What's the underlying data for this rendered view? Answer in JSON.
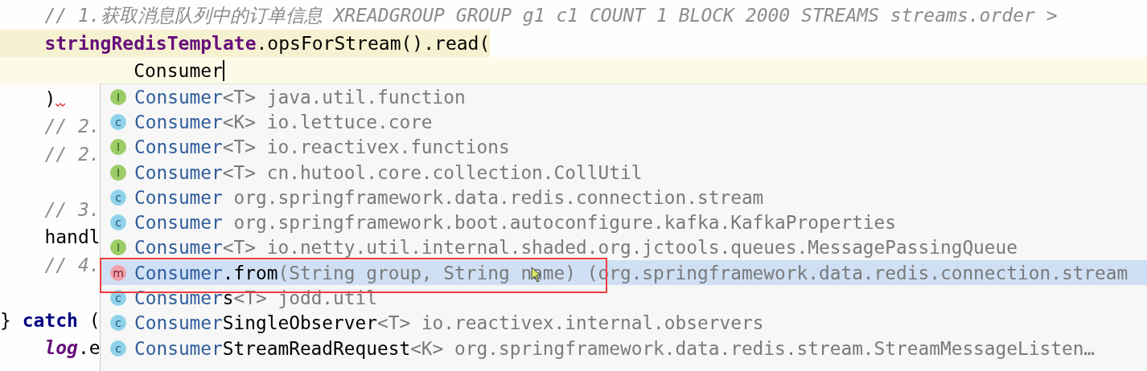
{
  "editor": {
    "lines": [
      {
        "segments": [
          {
            "kind": "comment",
            "text": "    // 1.获取消息队列中的订单信息 XREADGROUP GROUP g1 c1 COUNT 1 BLOCK 2000 STREAMS streams.order >"
          }
        ]
      },
      {
        "segments": [
          {
            "kind": "field",
            "text": "    stringRedisTemplate"
          },
          {
            "kind": "plain",
            "text": ".opsForStream().read("
          }
        ],
        "highlighted": true
      },
      {
        "segments": [
          {
            "kind": "plain",
            "text": "            Consumer"
          }
        ],
        "current": true,
        "caret": true
      },
      {
        "segments": [
          {
            "kind": "plain",
            "text": "    )"
          }
        ],
        "error": true
      },
      {
        "segments": [
          {
            "kind": "comment",
            "text": "    // 2."
          }
        ]
      },
      {
        "segments": [
          {
            "kind": "comment",
            "text": "    // 2."
          }
        ]
      },
      {
        "kind": "blank"
      },
      {
        "segments": [
          {
            "kind": "comment",
            "text": "    // 3."
          }
        ]
      },
      {
        "segments": [
          {
            "kind": "plain",
            "text": "    handl"
          }
        ]
      },
      {
        "segments": [
          {
            "kind": "comment",
            "text": "    // 4."
          }
        ]
      },
      {
        "kind": "blank"
      },
      {
        "segments": [
          {
            "kind": "plain",
            "text": "} "
          },
          {
            "kind": "keyword",
            "text": "catch"
          },
          {
            "kind": "plain",
            "text": " ("
          }
        ]
      },
      {
        "segments": [
          {
            "kind": "field-italic",
            "text": "    log"
          },
          {
            "kind": "plain",
            "text": ".e"
          }
        ]
      }
    ]
  },
  "popup": {
    "items": [
      {
        "kind": "interface",
        "icon_letter": "I",
        "name": "Consumer",
        "type_params": "<T>",
        "package": "java.util.function",
        "selected": false
      },
      {
        "kind": "class",
        "icon_letter": "c",
        "name": "Consumer",
        "type_params": "<K>",
        "package": "io.lettuce.core",
        "selected": false
      },
      {
        "kind": "interface",
        "icon_letter": "I",
        "name": "Consumer",
        "type_params": "<T>",
        "package": "io.reactivex.functions",
        "selected": false
      },
      {
        "kind": "interface",
        "icon_letter": "I",
        "name": "Consumer",
        "type_params": "<T>",
        "package": "cn.hutool.core.collection.CollUtil",
        "selected": false
      },
      {
        "kind": "class",
        "icon_letter": "c",
        "name": "Consumer",
        "package": "org.springframework.data.redis.connection.stream",
        "selected": false
      },
      {
        "kind": "class",
        "icon_letter": "c",
        "name": "Consumer",
        "package": "org.springframework.boot.autoconfigure.kafka.KafkaProperties",
        "selected": false
      },
      {
        "kind": "interface",
        "icon_letter": "I",
        "name": "Consumer",
        "type_params": "<T>",
        "package": "io.netty.util.internal.shaded.org.jctools.queues.MessagePassingQueue",
        "selected": false
      },
      {
        "kind": "method",
        "icon_letter": "m",
        "name": "Consumer",
        "suffix": ".from",
        "params": "(String group, String name)",
        "package": "(org.springframework.data.redis.connection.stream",
        "selected": true
      },
      {
        "kind": "class",
        "icon_letter": "c",
        "name": "Consumer",
        "suffix": "s",
        "type_params": "<T>",
        "package": "jodd.util",
        "selected": false
      },
      {
        "kind": "class",
        "icon_letter": "c",
        "name": "Consumer",
        "suffix": "SingleObserver",
        "type_params": "<T>",
        "package": "io.reactivex.internal.observers",
        "selected": false
      },
      {
        "kind": "class",
        "icon_letter": "c",
        "name": "Consumer",
        "suffix": "StreamReadRequest",
        "type_params": "<K>",
        "package": "org.springframework.data.redis.stream.StreamMessageListen…",
        "selected": false
      }
    ]
  }
}
